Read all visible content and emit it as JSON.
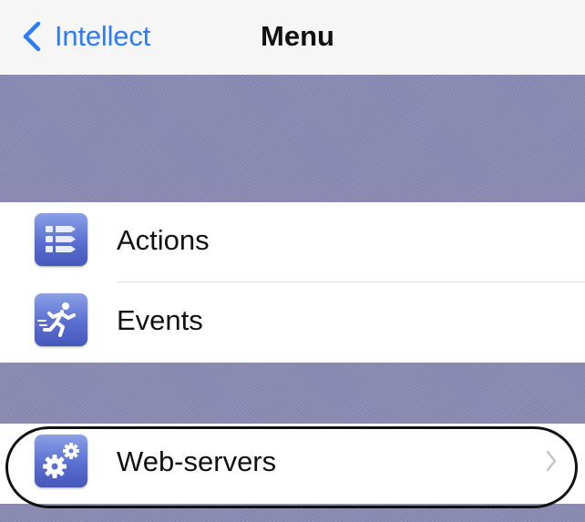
{
  "navbar": {
    "back_label": "Intellect",
    "back_icon": "chevron-left-icon",
    "title": "Menu"
  },
  "menu": {
    "items": [
      {
        "label": "Actions",
        "icon": "actions-list-icon"
      },
      {
        "label": "Events",
        "icon": "running-person-icon"
      },
      {
        "label": "Web-servers",
        "icon": "gears-icon",
        "disclosure_icon": "chevron-right-icon",
        "highlighted": true
      }
    ]
  },
  "colors": {
    "accent": "#2f7cf6",
    "section_band": "#8a8ab3",
    "icon_tile": "#5a6fd0",
    "highlight_ring": "#111111"
  }
}
